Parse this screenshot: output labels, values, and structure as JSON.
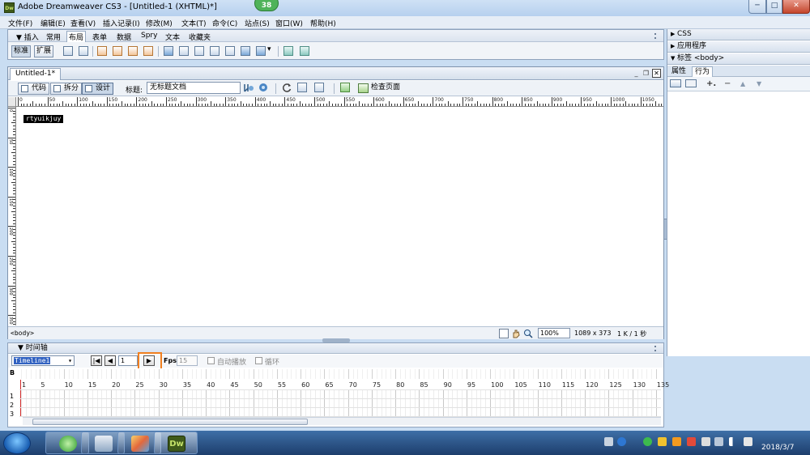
{
  "window": {
    "app_icon_text": "Dw",
    "title": "Adobe Dreamweaver CS3 - [Untitled-1 (XHTML)*]",
    "badge": "38",
    "min_glyph": "─",
    "max_glyph": "□",
    "close_glyph": "✕"
  },
  "menubar": {
    "items": [
      "文件(F)",
      "编辑(E)",
      "查看(V)",
      "插入记录(I)",
      "修改(M)",
      "文本(T)",
      "命令(C)",
      "站点(S)",
      "窗口(W)",
      "帮助(H)"
    ]
  },
  "insert_bar": {
    "title": "▼ 插入",
    "tabs": [
      "常用",
      "布局",
      "表单",
      "数据",
      "Spry",
      "文本",
      "收藏夹"
    ],
    "active_tab": "布局",
    "mode_buttons": [
      "标准",
      "扩展"
    ],
    "dropdown_arrow": "▾"
  },
  "document": {
    "tab_label": "Untitled-1*",
    "min_glyph": "_",
    "restore_glyph": "❐",
    "close_glyph": "✕",
    "view_buttons": [
      "代码",
      "拆分",
      "设计"
    ],
    "title_label": "标题:",
    "title_value": "无标题文档",
    "check_page_label": "检查页面",
    "ruler_labels": [
      "0",
      "50",
      "100",
      "150",
      "200",
      "250",
      "300",
      "350",
      "400",
      "450",
      "500",
      "550",
      "600",
      "650",
      "700",
      "750",
      "800",
      "850",
      "900",
      "950",
      "1000",
      "1050"
    ],
    "vruler_labels": [
      "0",
      "50",
      "100",
      "150",
      "200",
      "250",
      "300",
      "350"
    ],
    "content_text": "rtyuikjuy",
    "tag_selector": "<body>",
    "zoom": "100%",
    "window_size": "1089 x 373",
    "doc_size": "1 K / 1 秒"
  },
  "right_panel": {
    "groups": [
      "CSS",
      "应用程序",
      "标签 <body>"
    ],
    "tabs": [
      "属性",
      "行为"
    ],
    "active_tab": "行为",
    "tools": [
      "+.",
      "−",
      "▲",
      "▼"
    ]
  },
  "timeline": {
    "title": "▼ 时间轴",
    "select_value": "Timeline1",
    "frame_value": "1",
    "fps_label": "Fps",
    "fps_value": "15",
    "autoplay_label": "自动播放",
    "loop_label": "循环",
    "rewind_glyph": "|◀",
    "back_glyph": "◀",
    "play_glyph": "▶",
    "behavior_channel": "B",
    "frame_numbers": [
      "1",
      "5",
      "10",
      "15",
      "20",
      "25",
      "30",
      "35",
      "40",
      "45",
      "50",
      "55",
      "60",
      "65",
      "70",
      "75",
      "80",
      "85",
      "90",
      "95",
      "100",
      "105",
      "110",
      "115",
      "120",
      "125",
      "130",
      "135"
    ],
    "rows": [
      "1",
      "2",
      "3"
    ]
  },
  "taskbar": {
    "date": "2018/3/7"
  }
}
